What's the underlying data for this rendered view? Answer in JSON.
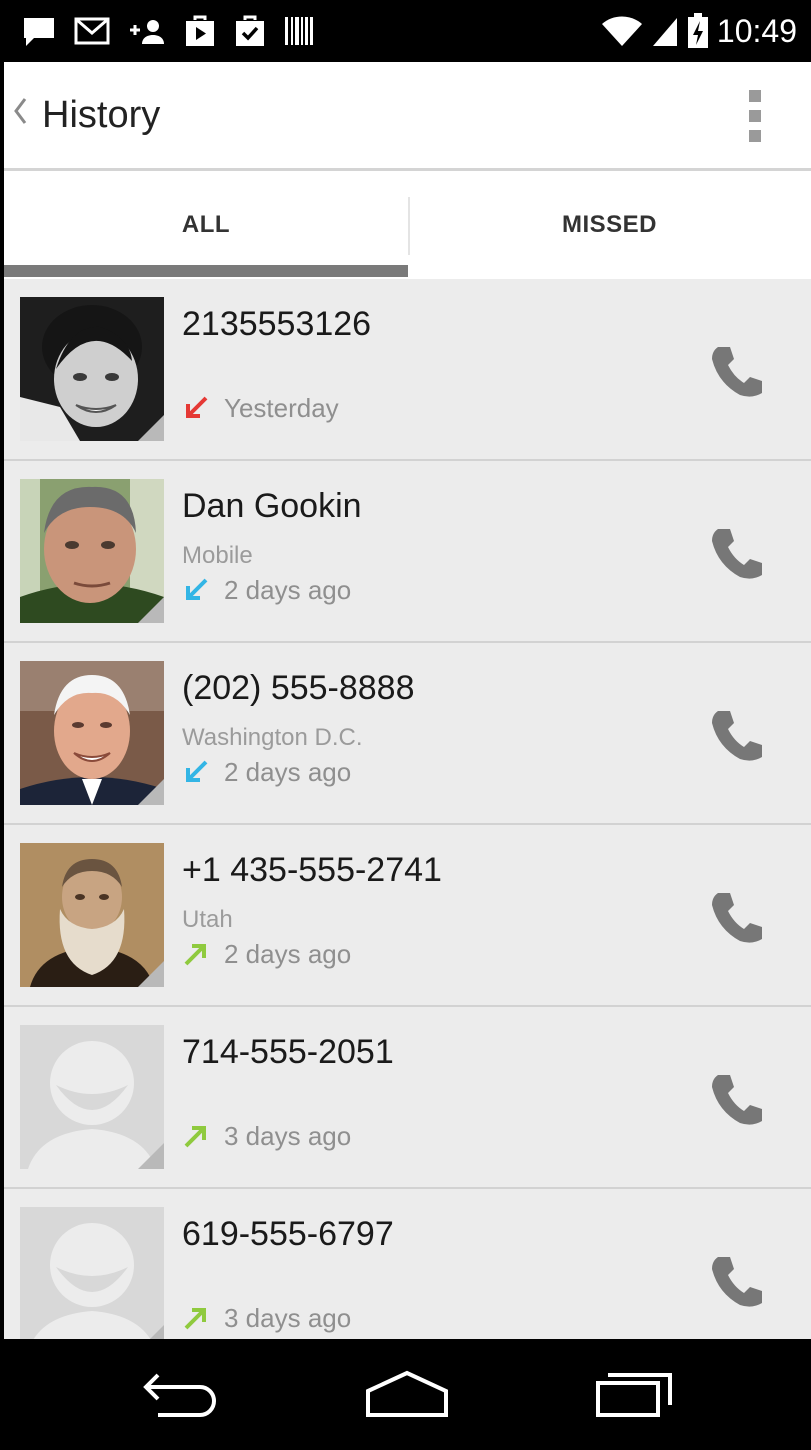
{
  "status_bar": {
    "time": "10:49",
    "left_icons": [
      "message-icon",
      "gmail-icon",
      "add-contact-icon",
      "play-store-icon",
      "shopping-bag-check-icon",
      "barcode-icon"
    ],
    "right_icons": [
      "wifi-icon",
      "cell-signal-icon",
      "battery-charging-icon"
    ]
  },
  "app_bar": {
    "title": "History",
    "icons": [
      "chevron-left-icon",
      "overflow-menu-icon"
    ]
  },
  "tabs": [
    {
      "label": "ALL",
      "selected": true
    },
    {
      "label": "MISSED",
      "selected": false
    }
  ],
  "calls": [
    {
      "name": "2135553126",
      "detail": "",
      "when": "Yesterday",
      "call_type": "missed",
      "avatar": "photo"
    },
    {
      "name": "Dan Gookin",
      "detail": "Mobile",
      "when": "2 days ago",
      "call_type": "incoming",
      "avatar": "photo"
    },
    {
      "name": "(202) 555-8888",
      "detail": "Washington D.C.",
      "when": "2 days ago",
      "call_type": "incoming",
      "avatar": "photo"
    },
    {
      "name": "+1 435-555-2741",
      "detail": "Utah",
      "when": "2 days ago",
      "call_type": "outgoing",
      "avatar": "photo"
    },
    {
      "name": "714-555-2051",
      "detail": "",
      "when": "3 days ago",
      "call_type": "outgoing",
      "avatar": "placeholder"
    },
    {
      "name": "619-555-6797",
      "detail": "",
      "when": "3 days ago",
      "call_type": "outgoing",
      "avatar": "placeholder"
    }
  ],
  "colors": {
    "missed": "#e53935",
    "incoming": "#33b5e5",
    "outgoing": "#8fca3e",
    "list_background": "#ececec",
    "tab_indicator": "#7a7a7a"
  },
  "nav_bar": {
    "icons": [
      "back-icon",
      "home-icon",
      "recent-apps-icon"
    ]
  }
}
